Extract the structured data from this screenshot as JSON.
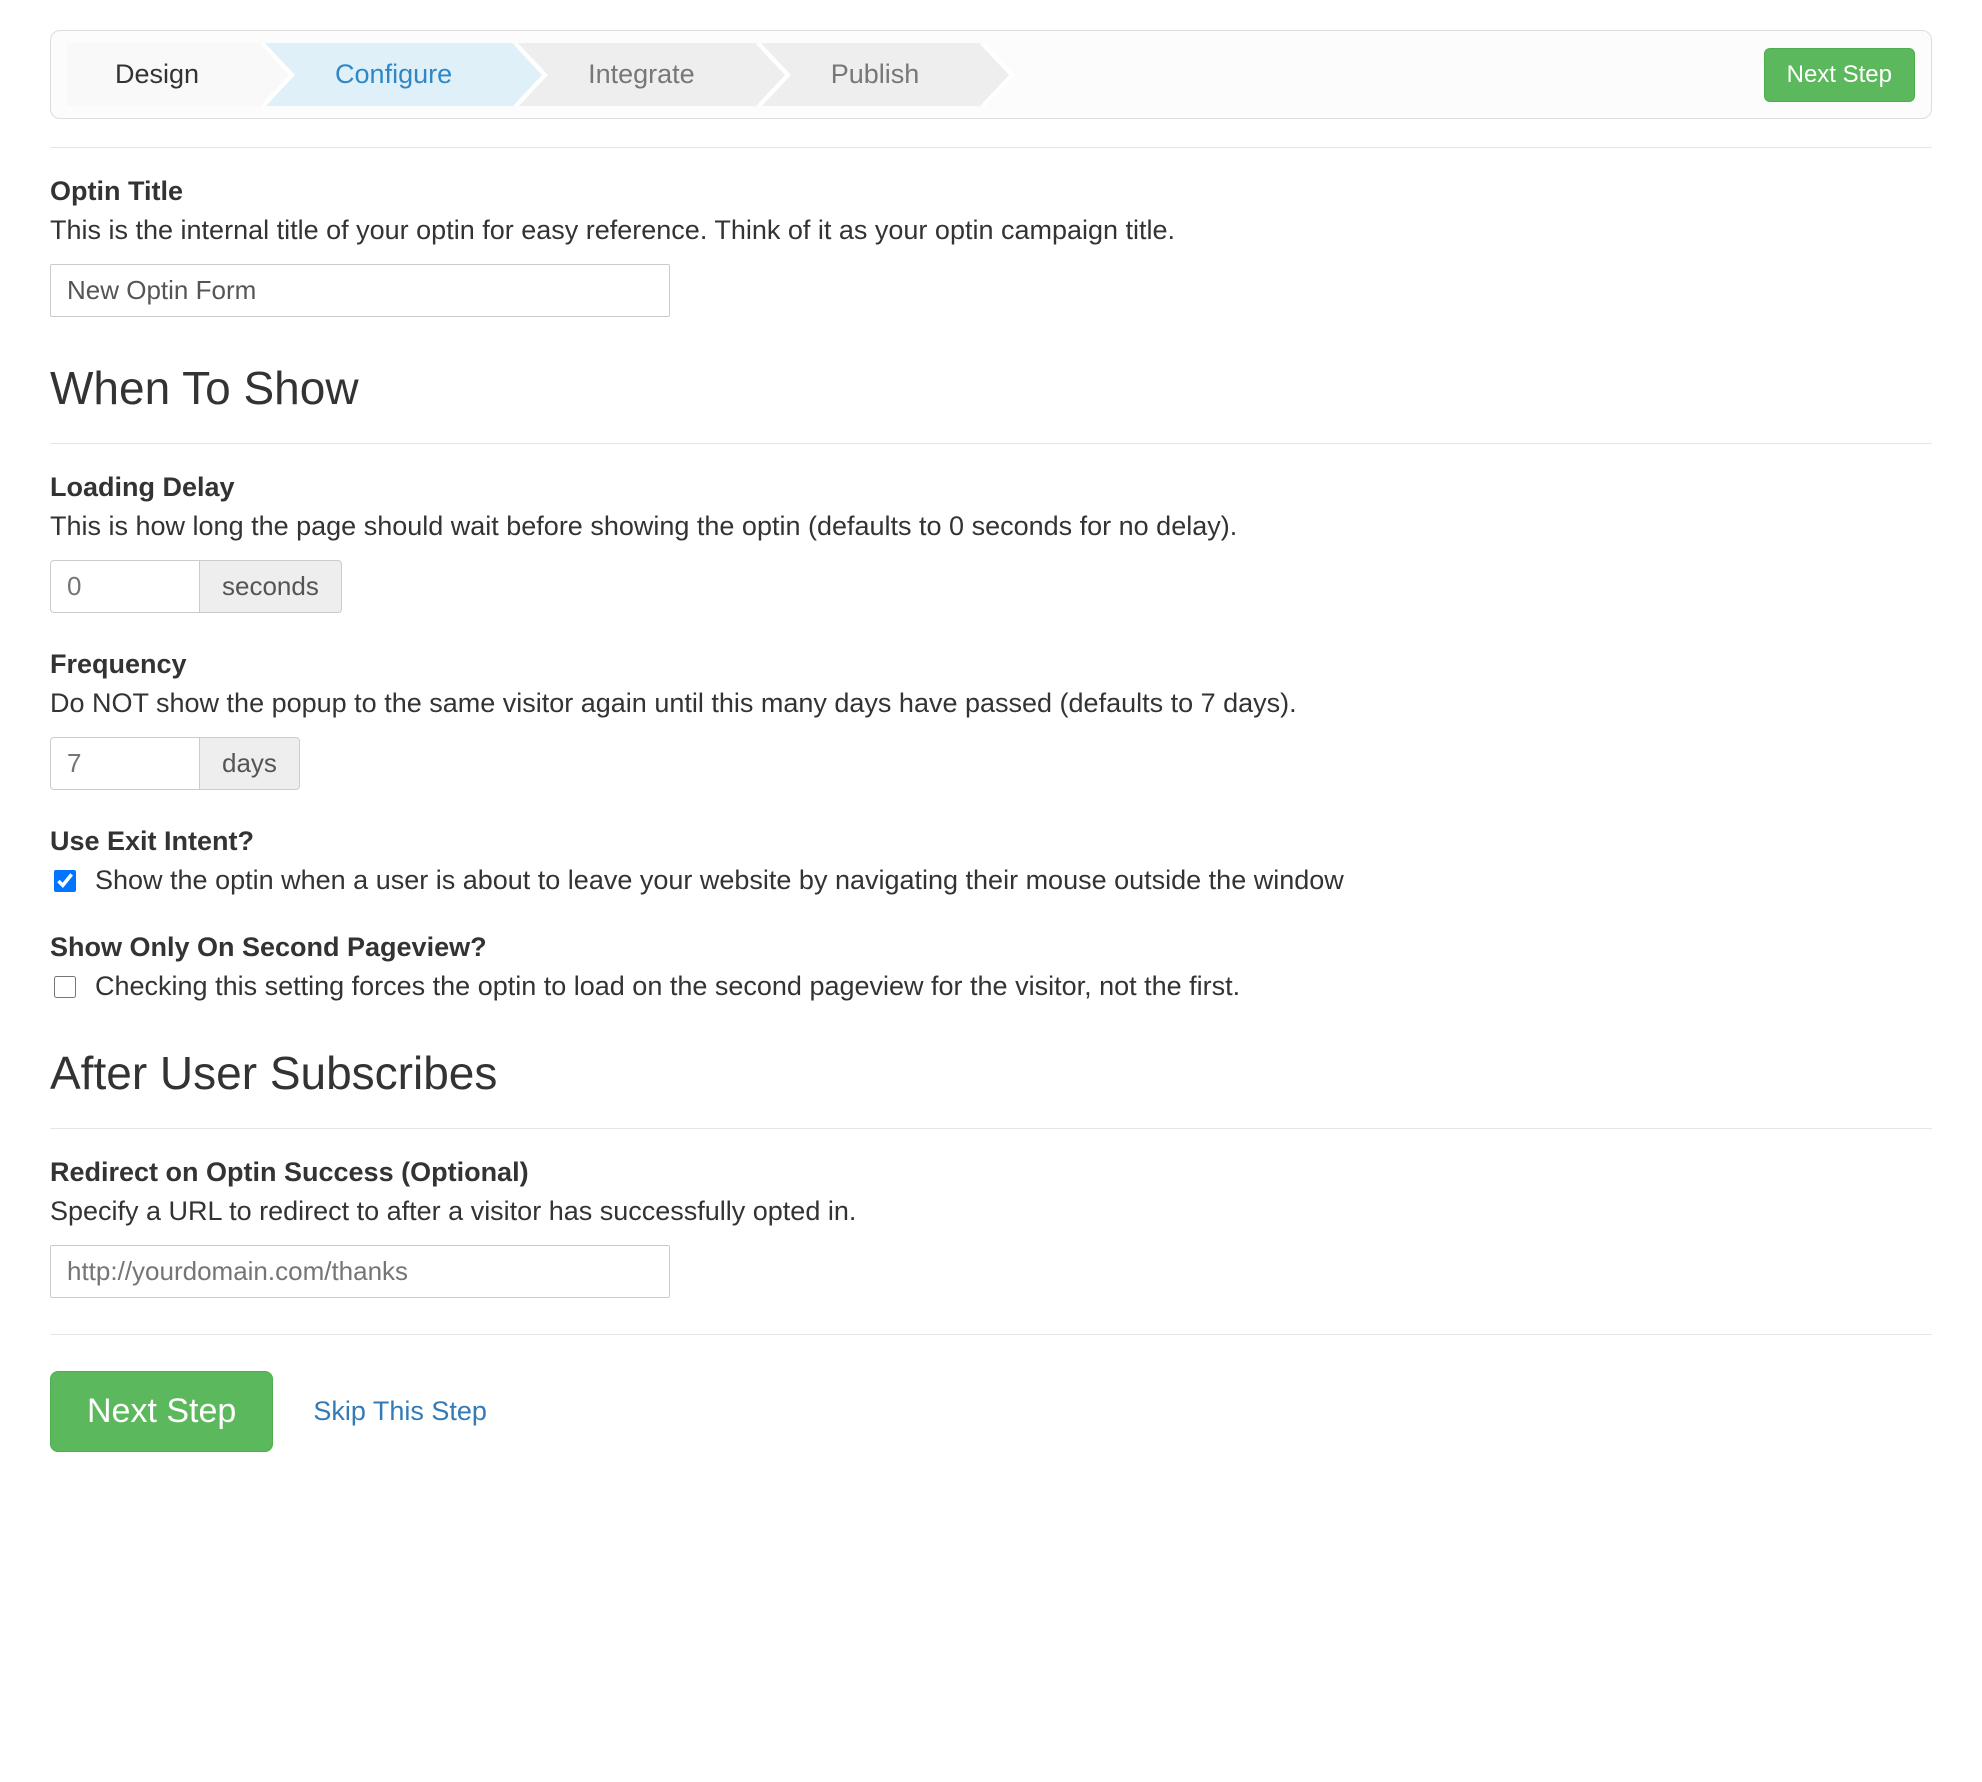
{
  "stepper": {
    "steps": [
      {
        "label": "Design"
      },
      {
        "label": "Configure"
      },
      {
        "label": "Integrate"
      },
      {
        "label": "Publish"
      }
    ],
    "next_button": "Next Step"
  },
  "optin_title": {
    "label": "Optin Title",
    "help": "This is the internal title of your optin for easy reference. Think of it as your optin campaign title.",
    "value": "New Optin Form"
  },
  "when_to_show": {
    "heading": "When To Show",
    "loading_delay": {
      "label": "Loading Delay",
      "help": "This is how long the page should wait before showing the optin (defaults to 0 seconds for no delay).",
      "value": "0",
      "unit": "seconds"
    },
    "frequency": {
      "label": "Frequency",
      "help": "Do NOT show the popup to the same visitor again until this many days have passed (defaults to 7 days).",
      "value": "7",
      "unit": "days"
    },
    "exit_intent": {
      "label": "Use Exit Intent?",
      "checked": true,
      "text": "Show the optin when a user is about to leave your website by navigating their mouse outside the window"
    },
    "second_pageview": {
      "label": "Show Only On Second Pageview?",
      "checked": false,
      "text": "Checking this setting forces the optin to load on the second pageview for the visitor, not the first."
    }
  },
  "after_subscribe": {
    "heading": "After User Subscribes",
    "redirect": {
      "label": "Redirect on Optin Success (Optional)",
      "help": "Specify a URL to redirect to after a visitor has successfully opted in.",
      "placeholder": "http://yourdomain.com/thanks"
    }
  },
  "bottom": {
    "next": "Next Step",
    "skip": "Skip This Step"
  }
}
